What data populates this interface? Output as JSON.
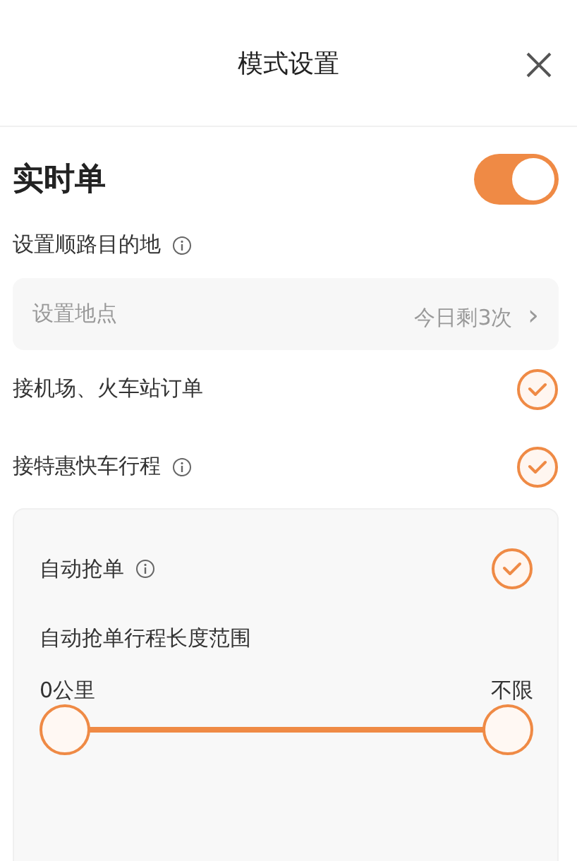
{
  "header": {
    "title": "模式设置"
  },
  "realtime": {
    "title": "实时单",
    "on": true
  },
  "destination": {
    "label": "设置顺路目的地",
    "placeholder": "设置地点",
    "remaining": "今日剩3次",
    "chevron": "›"
  },
  "options": [
    {
      "label": "接机场、火车站订单",
      "info": false,
      "checked": true
    },
    {
      "label": "接特惠快车行程",
      "info": true,
      "checked": true
    }
  ],
  "auto": {
    "label": "自动抢单",
    "info": true,
    "checked": true,
    "range_title": "自动抢单行程长度范围",
    "min_label": "0公里",
    "max_label": "不限",
    "level": 1
  }
}
